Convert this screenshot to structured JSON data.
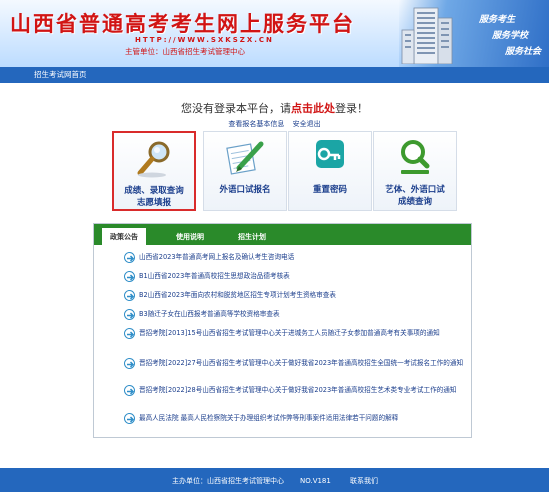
{
  "header": {
    "title": "山西省普通高考考生网上服务平台",
    "url": "HTTP://WWW.SXKSZX.CN",
    "sponsor": "主管单位：山西省招生考试管理中心",
    "slogans": [
      "服务考生",
      "服务学校",
      "服务社会"
    ]
  },
  "nav": {
    "home": "招生考试网首页"
  },
  "login": {
    "prefix": "您没有登录本平台，请",
    "link": "点击此处",
    "suffix": "登录！",
    "links": [
      "查看报名基本信息",
      "安全退出"
    ]
  },
  "tiles": [
    {
      "line1": "成绩、录取查询",
      "line2": "志愿填报",
      "icon": "magnifier-icon"
    },
    {
      "line1": "外语口试报名",
      "line2": "",
      "icon": "pencil-paper-icon"
    },
    {
      "line1": "重置密码",
      "line2": "",
      "icon": "key-icon"
    },
    {
      "line1": "艺体、外语口试",
      "line2": "成绩查询",
      "icon": "search-doc-icon"
    }
  ],
  "panel": {
    "tabs": [
      "政策公告",
      "使用说明",
      "招生计划"
    ],
    "notices": [
      "山西省2023年普通高考网上报名及确认考生咨询电话",
      "B1山西省2023年普通高校招生思想政治品德考核表",
      "B2山西省2023年面向农村和脱贫地区招生专项计划考生资格审查表",
      "B3随迁子女在山西报考普通高等学校资格审查表",
      "晋招考院[2013]15号山西省招生考试管理中心关于进城务工人员随迁子女参加普通高考有关事项的通知",
      "晋招考院[2022]27号山西省招生考试管理中心关于做好我省2023年普通高校招生全国统一考试报名工作的通知",
      "晋招考院[2022]28号山西省招生考试管理中心关于做好我省2023年普通高校招生艺术类专业考试工作的通知",
      "最高人民法院 最高人民检察院关于办理组织考试作弊等刑事案件适用法律若干问题的解释"
    ]
  },
  "footer": {
    "org": "主办单位：山西省招生考试管理中心",
    "no": "NO.V181",
    "contact": "联系我们"
  },
  "colors": {
    "brand_blue": "#2467bd",
    "title_red": "#d11414",
    "tab_green": "#2a8a2a",
    "highlight_red": "#d92b2b"
  }
}
